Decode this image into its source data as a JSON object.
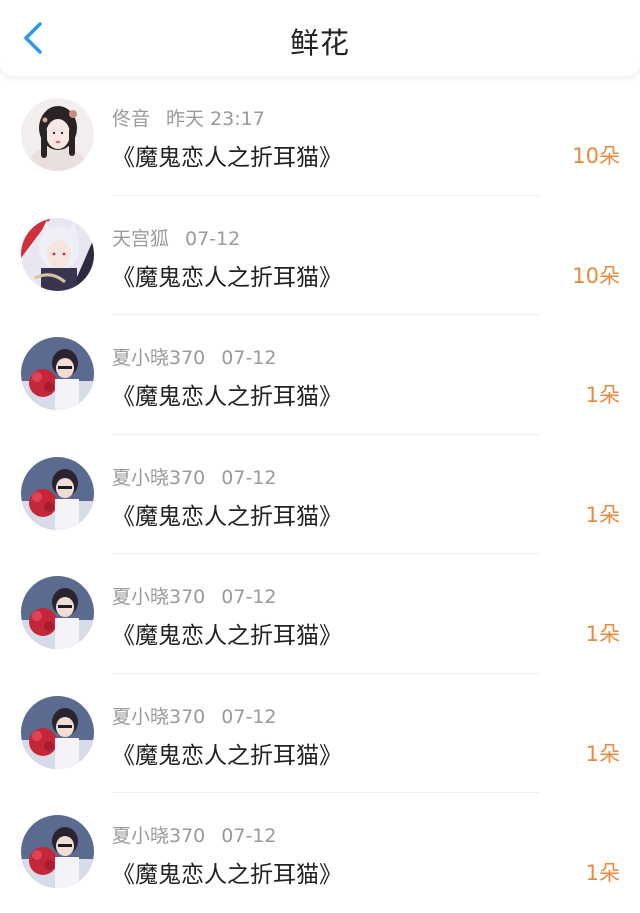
{
  "header": {
    "title": "鲜花",
    "back_icon": "chevron-left-icon",
    "accent_color": "#2b9af3"
  },
  "count_color": "#e98a3f",
  "items": [
    {
      "user": "佟音",
      "date": "昨天 23:17",
      "book": "《魔鬼恋人之折耳猫》",
      "count": "10朵",
      "avatar": "avatar-girl-white"
    },
    {
      "user": "天宫狐",
      "date": "07-12",
      "book": "《魔鬼恋人之折耳猫》",
      "count": "10朵",
      "avatar": "avatar-fox-spirit"
    },
    {
      "user": "夏小晓370",
      "date": "07-12",
      "book": "《魔鬼恋人之折耳猫》",
      "count": "1朵",
      "avatar": "avatar-boy-flowers"
    },
    {
      "user": "夏小晓370",
      "date": "07-12",
      "book": "《魔鬼恋人之折耳猫》",
      "count": "1朵",
      "avatar": "avatar-boy-flowers"
    },
    {
      "user": "夏小晓370",
      "date": "07-12",
      "book": "《魔鬼恋人之折耳猫》",
      "count": "1朵",
      "avatar": "avatar-boy-flowers"
    },
    {
      "user": "夏小晓370",
      "date": "07-12",
      "book": "《魔鬼恋人之折耳猫》",
      "count": "1朵",
      "avatar": "avatar-boy-flowers"
    },
    {
      "user": "夏小晓370",
      "date": "07-12",
      "book": "《魔鬼恋人之折耳猫》",
      "count": "1朵",
      "avatar": "avatar-boy-flowers"
    }
  ]
}
